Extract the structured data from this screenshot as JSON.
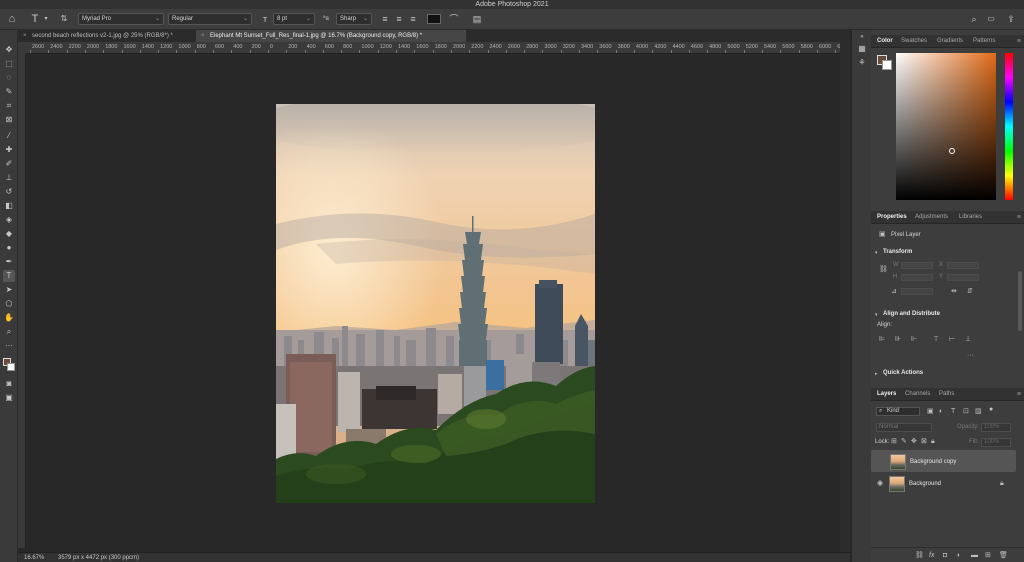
{
  "app": {
    "title": "Adobe Photoshop 2021"
  },
  "options_bar": {
    "font_family": "Myriad Pro",
    "font_style": "Regular",
    "font_size": "8 pt",
    "antialias": "Sharp",
    "text_color": "#111111"
  },
  "tabs": [
    {
      "label": "second beach reflections v2-1.jpg @ 25% (RGB/8*) *",
      "active": false
    },
    {
      "label": "Elephant Mt Sunset_Full_Res_final-1.jpg @ 16.7% (Background copy, RGB/8) *",
      "active": true
    }
  ],
  "ruler": {
    "labels": [
      "2600",
      "2400",
      "2200",
      "2000",
      "1800",
      "1600",
      "1400",
      "1200",
      "1000",
      "800",
      "600",
      "400",
      "200",
      "0",
      "200",
      "400",
      "600",
      "800",
      "1000",
      "1200",
      "1400",
      "1600",
      "1800",
      "2000",
      "2200",
      "2400",
      "2600",
      "2800",
      "3000",
      "3200",
      "3400",
      "3600",
      "3800",
      "4000",
      "4200",
      "4400",
      "4600",
      "4800",
      "5000",
      "5200",
      "5400",
      "5600",
      "5800",
      "6000",
      "6200"
    ]
  },
  "status": {
    "zoom": "16.67%",
    "doc_info": "3579 px x 4472 px (300 ppcm)"
  },
  "color_panel": {
    "tabs": [
      "Color",
      "Swatches",
      "Gradients",
      "Patterns"
    ],
    "foreground": "#6a4c3d",
    "background": "#ffffff",
    "hue_color": "#e06a16"
  },
  "properties_panel": {
    "tabs": [
      "Properties",
      "Adjustments",
      "Libraries"
    ],
    "layer_type": "Pixel Layer",
    "transform_title": "Transform",
    "fields": {
      "w": "W",
      "h": "H",
      "x": "X",
      "y": "Y"
    },
    "align_title": "Align and Distribute",
    "align_label": "Align:",
    "quick_actions": "Quick Actions"
  },
  "layers_panel": {
    "tabs": [
      "Layers",
      "Channels",
      "Paths"
    ],
    "filter": "Kind",
    "blend_mode": "Normal",
    "opacity_label": "Opacity:",
    "opacity_value": "100%",
    "lock_label": "Lock:",
    "fill_label": "Fill:",
    "fill_value": "100%",
    "layers": [
      {
        "name": "Background copy",
        "selected": true,
        "visible": false,
        "locked": false
      },
      {
        "name": "Background",
        "selected": false,
        "visible": true,
        "locked": true
      }
    ]
  },
  "icons": {
    "home": "home-icon",
    "text_tool": "type-tool-icon",
    "search": "search-icon",
    "workspace": "workspace-icon",
    "share": "share-icon"
  }
}
